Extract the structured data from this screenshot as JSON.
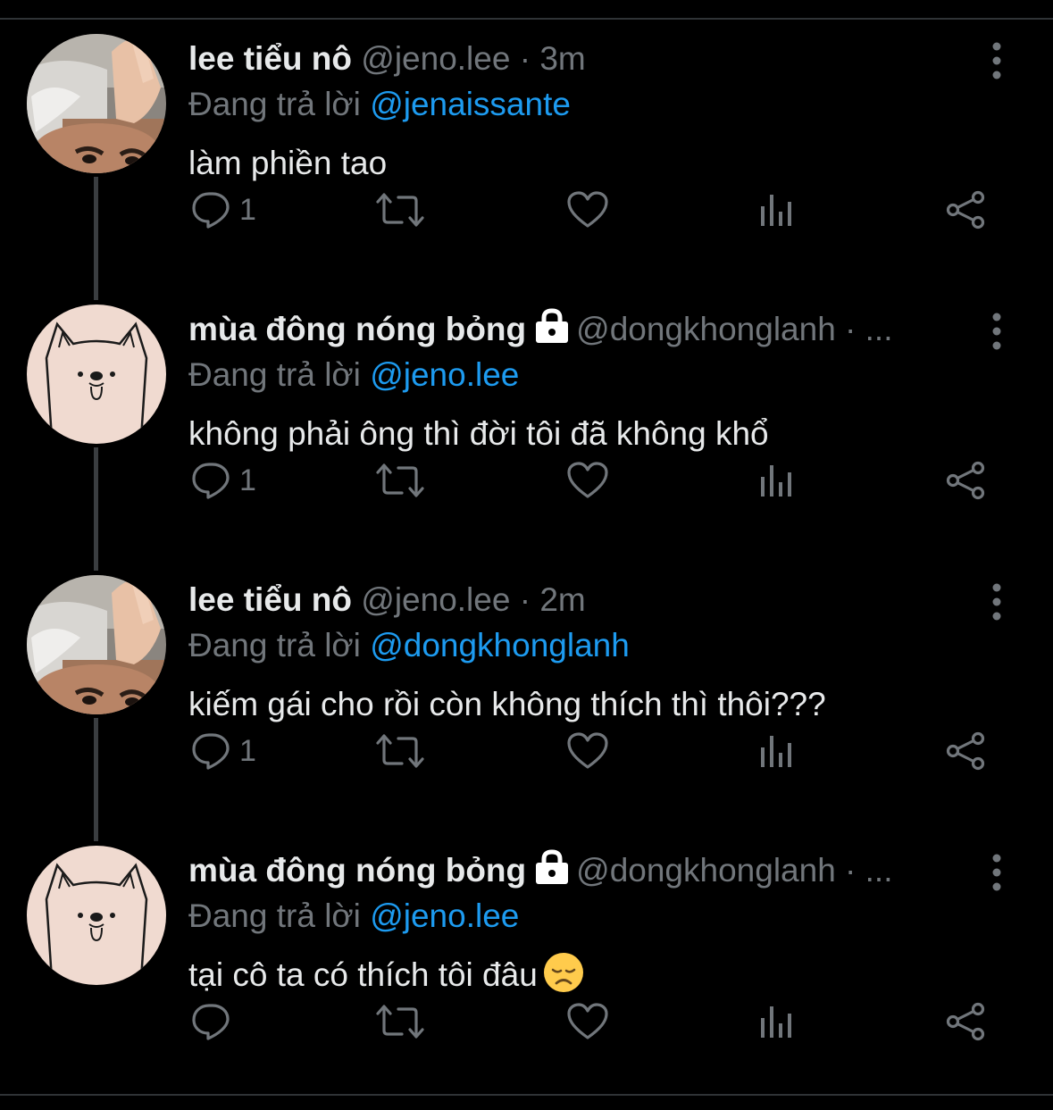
{
  "tweets": [
    {
      "author": "lee tiểu nô",
      "handle": "@jeno.lee",
      "time": "· 3m",
      "locked": false,
      "reply_prefix": "Đang trả lời",
      "reply_to": "@jenaissante",
      "text": "làm phiền tao",
      "reply_count": "1",
      "avatar": "photo-avatar"
    },
    {
      "author": "mùa đông nóng bỏng",
      "handle": "@dongkhonglanh · ...",
      "time": "",
      "locked": true,
      "reply_prefix": "Đang trả lời",
      "reply_to": "@jeno.lee",
      "text": "không phải ông thì đời tôi đã không khổ",
      "reply_count": "1",
      "avatar": "dog-drawing-avatar"
    },
    {
      "author": "lee tiểu nô",
      "handle": "@jeno.lee",
      "time": "· 2m",
      "locked": false,
      "reply_prefix": "Đang trả lời",
      "reply_to": "@dongkhonglanh",
      "text": "kiếm gái cho rồi còn không thích thì thôi???",
      "reply_count": "1",
      "avatar": "photo-avatar"
    },
    {
      "author": "mùa đông nóng bỏng",
      "handle": "@dongkhonglanh · ...",
      "time": "",
      "locked": true,
      "reply_prefix": "Đang trả lời",
      "reply_to": "@jeno.lee",
      "text": "tại cô ta có thích tôi đâu",
      "emoji": "disappointed-face",
      "reply_count": "",
      "avatar": "dog-drawing-avatar"
    }
  ],
  "icons": {
    "reply": "reply-icon",
    "retweet": "retweet-icon",
    "like": "heart-icon",
    "views": "views-icon",
    "share": "share-icon",
    "menu": "more-vertical-icon",
    "lock": "lock-icon"
  },
  "colors": {
    "background": "#000000",
    "text": "#e7e9ea",
    "secondary": "#71767b",
    "link": "#1d9bf0"
  }
}
